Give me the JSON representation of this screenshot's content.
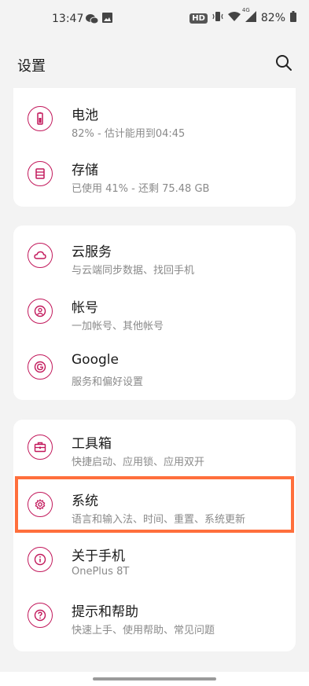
{
  "status": {
    "time": "13:47",
    "hd": "HD",
    "network": "4G",
    "battery": "82%"
  },
  "header": {
    "title": "设置"
  },
  "cards": [
    {
      "items": [
        {
          "title": "电池",
          "subtitle": "82% - 估计能用到04:45",
          "icon": "battery-icon"
        },
        {
          "title": "存储",
          "subtitle": "已使用 41% - 还剩 75.48 GB",
          "icon": "storage-icon"
        }
      ]
    },
    {
      "items": [
        {
          "title": "云服务",
          "subtitle": "与云端同步数据、找回手机",
          "icon": "cloud-icon"
        },
        {
          "title": "帐号",
          "subtitle": "一加帐号、其他帐号",
          "icon": "account-icon"
        },
        {
          "title": "Google",
          "subtitle": "服务和偏好设置",
          "icon": "google-icon"
        }
      ]
    },
    {
      "items": [
        {
          "title": "工具箱",
          "subtitle": "快捷启动、应用锁、应用双开",
          "icon": "toolbox-icon"
        },
        {
          "title": "系统",
          "subtitle": "语言和输入法、时间、重置、系统更新",
          "icon": "gear-icon"
        },
        {
          "title": "关于手机",
          "subtitle": "OnePlus 8T",
          "icon": "info-icon"
        },
        {
          "title": "提示和帮助",
          "subtitle": "快速上手、使用帮助、常见问题",
          "icon": "help-icon"
        }
      ]
    }
  ],
  "colors": {
    "accent": "#c2185b",
    "highlight": "#ff6f3c"
  }
}
